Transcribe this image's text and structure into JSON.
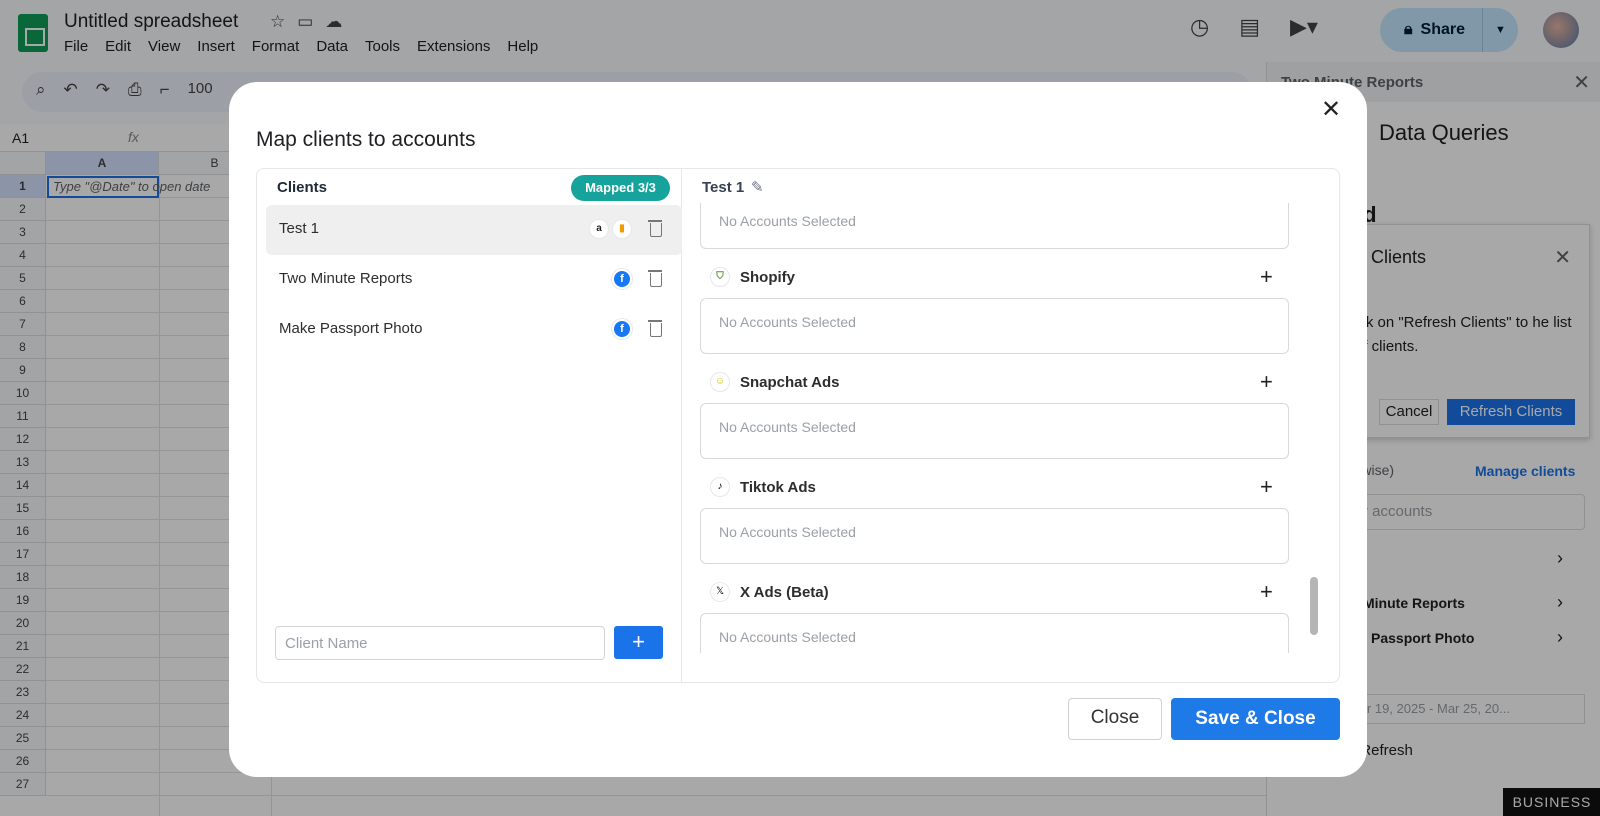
{
  "sheets": {
    "doc_title": "Untitled spreadsheet",
    "menu": [
      "File",
      "Edit",
      "View",
      "Insert",
      "Format",
      "Data",
      "Tools",
      "Extensions",
      "Help"
    ],
    "share_label": "Share",
    "zoom": "100",
    "name_box": "A1",
    "fx": "fx",
    "columns": [
      "A",
      "B"
    ],
    "rows": [
      "1",
      "2",
      "3",
      "4",
      "5",
      "6",
      "7",
      "8",
      "9",
      "10",
      "11",
      "12",
      "13",
      "14",
      "15",
      "16",
      "17",
      "18",
      "19",
      "20",
      "21",
      "22",
      "23",
      "24",
      "25",
      "26",
      "27"
    ],
    "cell_a1": "Type \"@Date\" to open date"
  },
  "sidebar": {
    "header": "Two Minute Reports",
    "title": "Data Queries",
    "heading_fragment": "ld",
    "dialog": {
      "title": "Clients",
      "text": "ick on \"Refresh Clients\" to he list of clients.",
      "cancel": "Cancel",
      "refresh": "Refresh Clients"
    },
    "client_wise": "lient-wise)",
    "manage_clients": "Manage clients",
    "search_placeholder": "n for accounts",
    "items": [
      "Minute Reports",
      "Passport Photo"
    ],
    "date_range": "5 Mar 19, 2025 - Mar 25, 20...",
    "smart_refresh": "rt Refresh",
    "business": "BUSINESS"
  },
  "modal": {
    "title": "Map clients to accounts",
    "clients_label": "Clients",
    "mapped_badge": "Mapped 3/3",
    "clients": [
      {
        "name": "Test 1",
        "icons": [
          "amazon-icon",
          "analytics-icon"
        ],
        "active": true
      },
      {
        "name": "Two Minute Reports",
        "icons": [
          "facebook-icon"
        ],
        "active": false
      },
      {
        "name": "Make Passport Photo",
        "icons": [
          "facebook-icon"
        ],
        "active": false
      }
    ],
    "client_input_placeholder": "Client Name",
    "selected_client": "Test 1",
    "empty_text": "No Accounts Selected",
    "platforms": [
      {
        "name": "Shopify",
        "icon": "shopify-icon"
      },
      {
        "name": "Snapchat Ads",
        "icon": "snapchat-icon"
      },
      {
        "name": "Tiktok Ads",
        "icon": "tiktok-icon"
      },
      {
        "name": "X Ads (Beta)",
        "icon": "x-icon"
      }
    ],
    "close_label": "Close",
    "save_label": "Save & Close"
  },
  "colors": {
    "accent": "#1e7ae6",
    "mapped_badge": "#15a39b",
    "sheets_green": "#0f9d58"
  }
}
